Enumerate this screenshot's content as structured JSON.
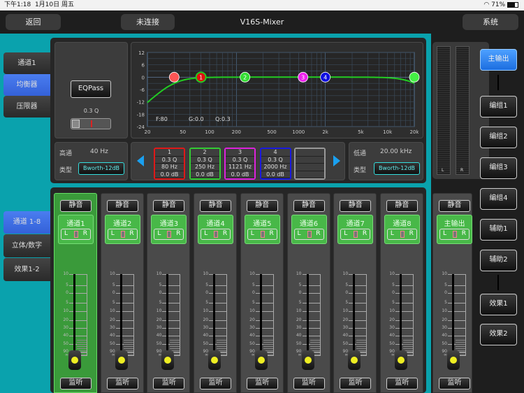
{
  "status": {
    "time": "下午1:18",
    "date": "1月10日 周五",
    "battery": "71%"
  },
  "header": {
    "back": "返回",
    "connection": "未连接",
    "title": "V16S-Mixer",
    "system": "系统"
  },
  "top_tabs": [
    "通道1",
    "均衡器",
    "压限器"
  ],
  "bottom_tabs": [
    "通道 1-8",
    "立体/数字",
    "效果1-2"
  ],
  "eq": {
    "eqpass": "EQPass",
    "q_label": "0.3 Q",
    "readout": {
      "f": "F:80",
      "g": "G:0.0",
      "q": "Q:0.3"
    },
    "y_ticks": [
      "12",
      "6",
      "0",
      "-6",
      "-12",
      "-18",
      "-24"
    ],
    "x_ticks": [
      "20",
      "50",
      "100",
      "200",
      "500",
      "1000",
      "2k",
      "5k",
      "10k",
      "20k"
    ],
    "highpass": {
      "label": "高通",
      "value": "40 Hz",
      "type_label": "类型",
      "type": "Bworth-12dB"
    },
    "lowpass": {
      "label": "低通",
      "value": "20.00 kHz",
      "type_label": "类型",
      "type": "Bworth-12dB"
    },
    "bands": [
      {
        "n": "1",
        "q": "0.3 Q",
        "f": "80 Hz",
        "g": "0.0 dB",
        "color": "#e01818"
      },
      {
        "n": "2",
        "q": "0.3 Q",
        "f": "250 Hz",
        "g": "0.0 dB",
        "color": "#33cc33"
      },
      {
        "n": "3",
        "q": "0.3 Q",
        "f": "1121 Hz",
        "g": "0.0 dB",
        "color": "#dd22dd"
      },
      {
        "n": "4",
        "q": "0.3 Q",
        "f": "2000 Hz",
        "g": "0.0 dB",
        "color": "#1a1ae0"
      }
    ],
    "nodes": [
      {
        "label": "",
        "freq": 40,
        "gain": 0,
        "color": "#ff5555"
      },
      {
        "label": "1",
        "freq": 80,
        "gain": 0,
        "color": "#e01010"
      },
      {
        "label": "2",
        "freq": 250,
        "gain": 0,
        "color": "#33dd33"
      },
      {
        "label": "3",
        "freq": 1121,
        "gain": 0,
        "color": "#ee22ee"
      },
      {
        "label": "4",
        "freq": 2000,
        "gain": 0,
        "color": "#1010e0"
      },
      {
        "label": "",
        "freq": 20000,
        "gain": 0,
        "color": "#44ee44"
      }
    ],
    "hp_freq": 40,
    "lp_freq": 20000
  },
  "fader_scale": [
    "10",
    "5",
    "0",
    "5",
    "10",
    "20",
    "30",
    "40",
    "50",
    "90",
    "∞"
  ],
  "strip_buttons": {
    "mute": "静音",
    "monitor": "监听",
    "left": "L",
    "right": "R"
  },
  "channels": [
    "通道1",
    "通道2",
    "通道3",
    "通道4",
    "通道5",
    "通道6",
    "通道7",
    "通道8"
  ],
  "master": {
    "name": "主输出",
    "meter_l": "L",
    "meter_r": "R"
  },
  "buses": [
    "主输出",
    "编组1",
    "编组2",
    "编组3",
    "编组4",
    "辅助1",
    "辅助2",
    "效果1",
    "效果2"
  ]
}
